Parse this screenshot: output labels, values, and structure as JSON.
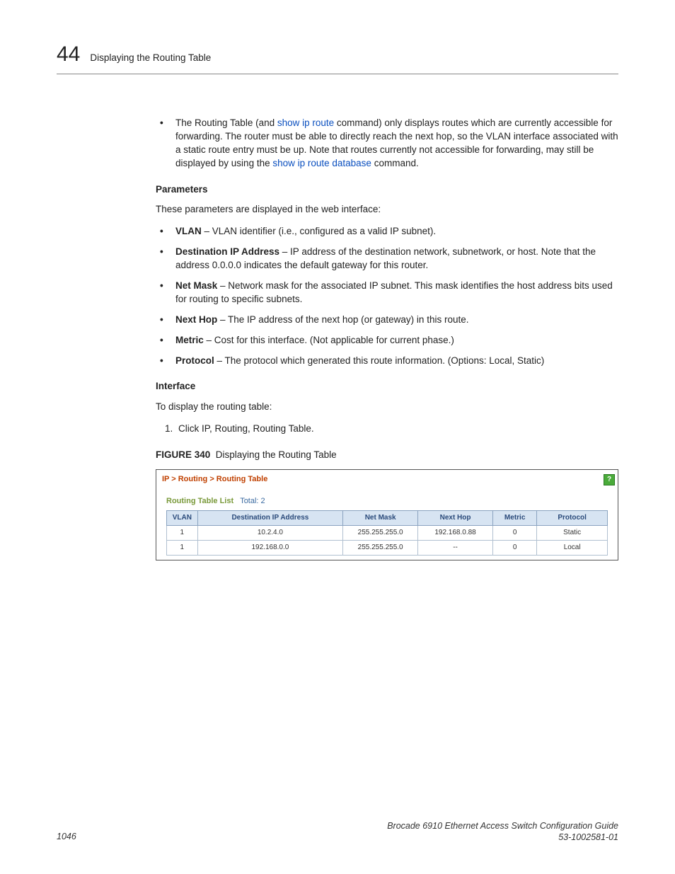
{
  "header": {
    "chapter_number": "44",
    "chapter_title": "Displaying the Routing Table"
  },
  "intro_bullet": {
    "prefix": "The Routing Table (and ",
    "link1": "show ip route",
    "mid1": " command) only displays routes which are currently accessible for forwarding. The router must be able to directly reach the next hop, so the VLAN interface associated with a static route entry must be up. Note that routes currently not accessible for forwarding, may still be displayed by using the ",
    "link2": "show ip route database",
    "suffix": " command."
  },
  "sections": {
    "parameters_label": "Parameters",
    "parameters_intro": "These parameters are displayed in the web interface:",
    "interface_label": "Interface",
    "interface_intro": "To display the routing table:",
    "step1": "Click IP, Routing, Routing Table."
  },
  "params": [
    {
      "term": "VLAN",
      "desc": " – VLAN identifier (i.e., configured as a valid IP subnet)."
    },
    {
      "term": "Destination IP Address",
      "desc": " – IP address of the destination network, subnetwork, or host. Note that the address 0.0.0.0 indicates the default gateway for this router."
    },
    {
      "term": "Net Mask",
      "desc": " – Network mask for the associated IP subnet. This mask identifies the host address bits used for routing to specific subnets."
    },
    {
      "term": "Next Hop",
      "desc": " – The IP address of the next hop (or gateway) in this route."
    },
    {
      "term": "Metric",
      "desc": " – Cost for this interface. (Not applicable for current phase.)"
    },
    {
      "term": "Protocol",
      "desc": " – The protocol which generated this route information. (Options: Local, Static)"
    }
  ],
  "figure": {
    "label": "FIGURE 340",
    "caption": "Displaying the Routing Table",
    "breadcrumb": "IP > Routing > Routing Table",
    "list_title": "Routing Table List",
    "total_label": "Total:",
    "total_value": "2",
    "columns": [
      "VLAN",
      "Destination IP Address",
      "Net Mask",
      "Next Hop",
      "Metric",
      "Protocol"
    ],
    "rows": [
      {
        "vlan": "1",
        "dest": "10.2.4.0",
        "mask": "255.255.255.0",
        "hop": "192.168.0.88",
        "metric": "0",
        "proto": "Static"
      },
      {
        "vlan": "1",
        "dest": "192.168.0.0",
        "mask": "255.255.255.0",
        "hop": "--",
        "metric": "0",
        "proto": "Local"
      }
    ]
  },
  "footer": {
    "page_number": "1046",
    "doc_title": "Brocade 6910 Ethernet Access Switch Configuration Guide",
    "doc_number": "53-1002581-01"
  }
}
